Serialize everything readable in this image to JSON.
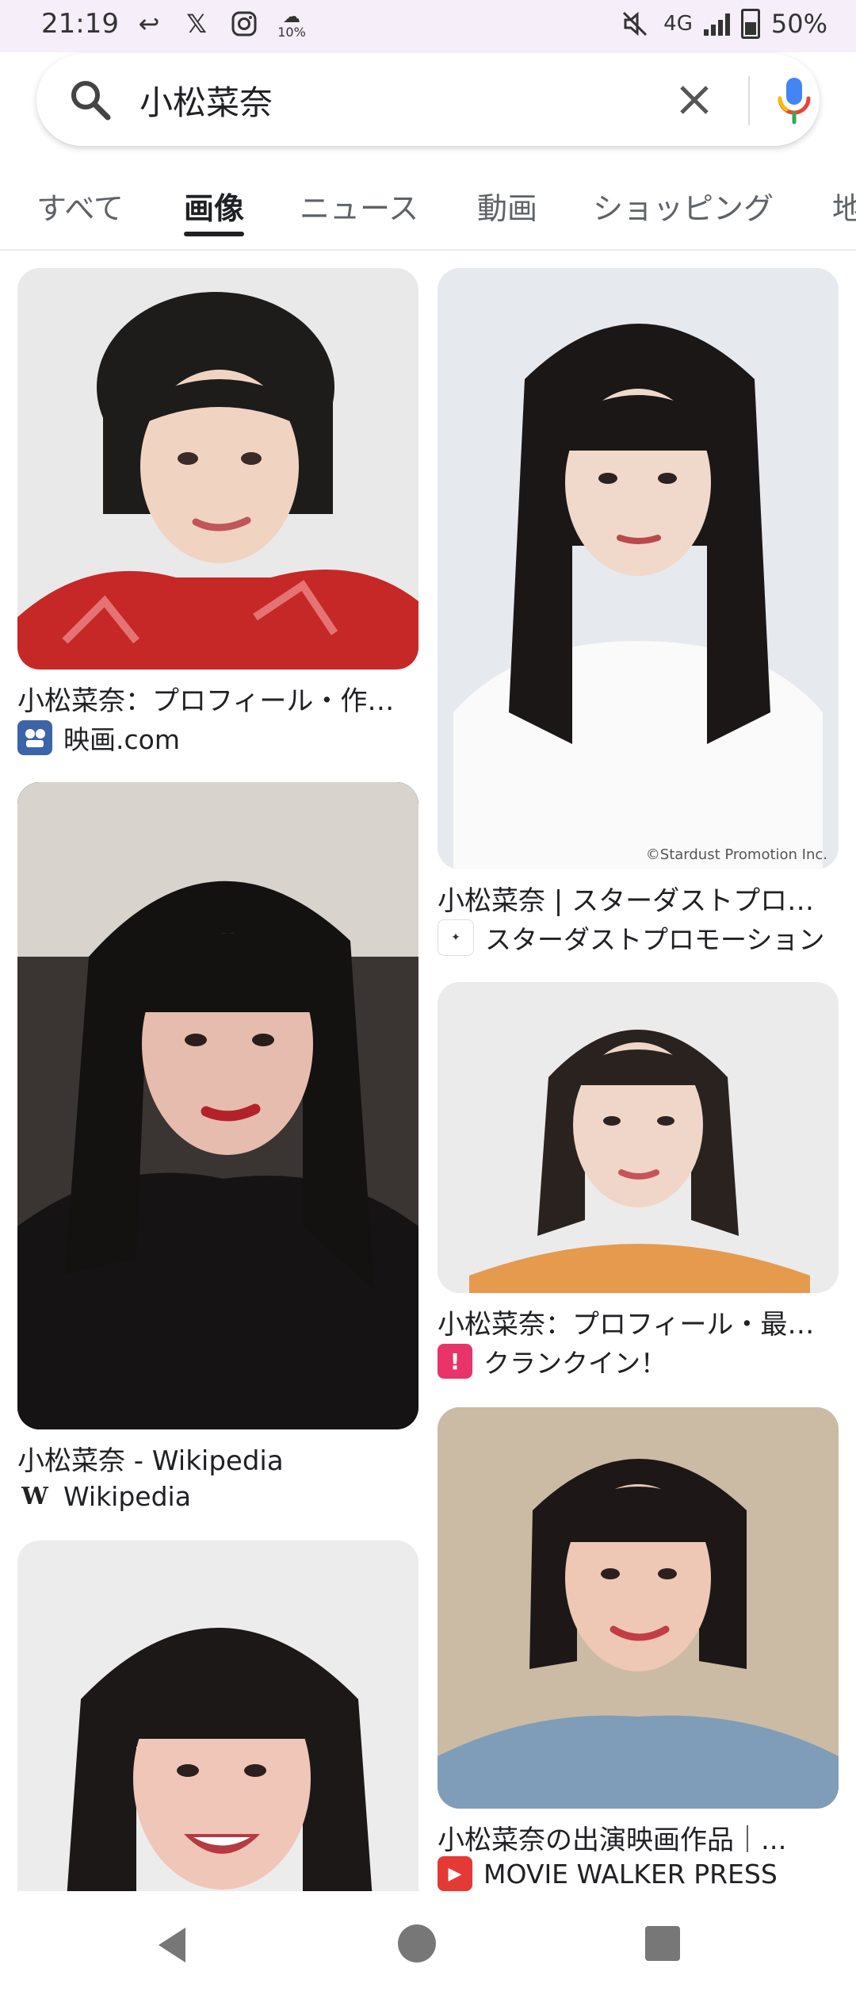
{
  "status": {
    "time": "21:19",
    "network": "4G",
    "battery": "50%",
    "cloud_percent": "10%"
  },
  "search": {
    "query": "小松菜奈"
  },
  "tabs": [
    {
      "label": "すべて"
    },
    {
      "label": "画像"
    },
    {
      "label": "ニュース"
    },
    {
      "label": "動画"
    },
    {
      "label": "ショッピング"
    },
    {
      "label": "地"
    }
  ],
  "results": [
    {
      "title": "小松菜奈：プロフィール・作品...",
      "source": "映画.com"
    },
    {
      "title": "小松菜奈 | スターダストプロモ...",
      "source": "スターダストプロモーション",
      "watermark": "©Stardust Promotion Inc."
    },
    {
      "title": "小松菜奈 - Wikipedia",
      "source": "Wikipedia"
    },
    {
      "title": "小松菜奈：プロフィール・最新...",
      "source": "クランクイン！"
    },
    {
      "title": "小松菜奈の出演映画作品｜...",
      "source": "MOVIE WALKER PRESS"
    }
  ],
  "colors": {
    "accent": "#202124",
    "status_bg": "#f6eef8",
    "mic_blue": "#4285f4",
    "mic_red": "#ea4335",
    "mic_yellow": "#fbbc04",
    "mic_green": "#34a853"
  }
}
